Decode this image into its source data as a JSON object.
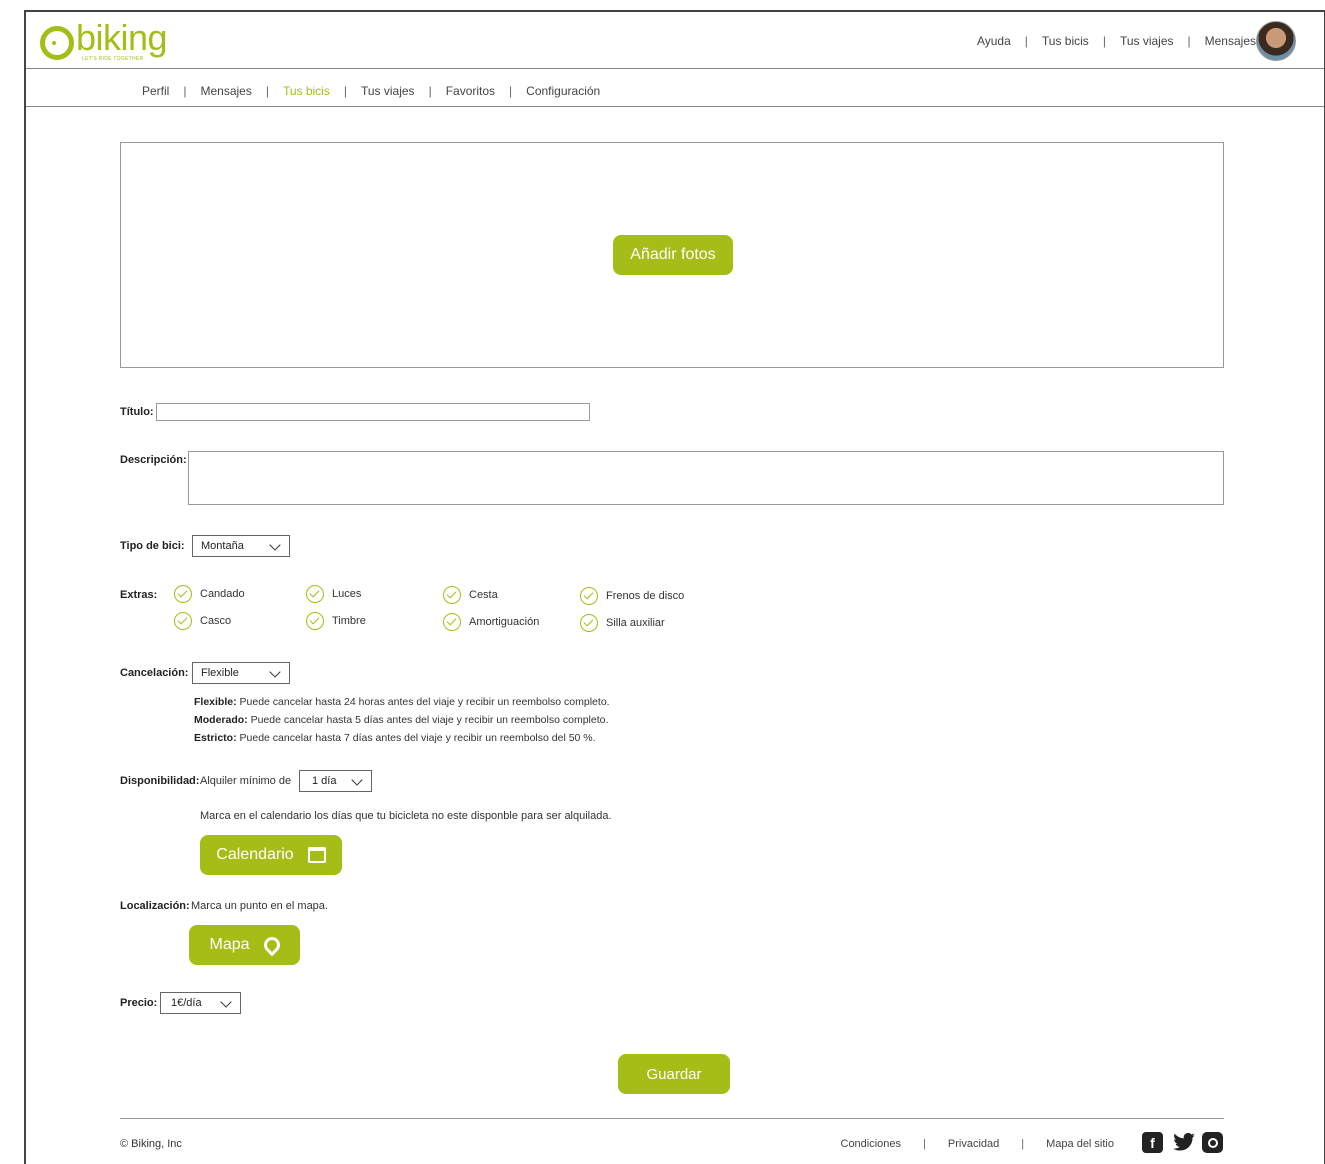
{
  "brand": {
    "name": "biking",
    "tagline": "LET'S RIDE TOGETHER",
    "accent": "#a5bd17"
  },
  "topnav": [
    "Ayuda",
    "Tus bicis",
    "Tus viajes",
    "Mensajes"
  ],
  "subnav": [
    "Perfil",
    "Mensajes",
    "Tus bicis",
    "Tus viajes",
    "Favoritos",
    "Configuración"
  ],
  "photos": {
    "button": "Añadir fotos"
  },
  "form": {
    "titulo_label": "Título:",
    "titulo_value": "",
    "descripcion_label": "Descripción:",
    "descripcion_value": "",
    "tipo_label": "Tipo de bici:",
    "tipo_value": "Montaña",
    "extras_label": "Extras:",
    "extras": [
      "Candado",
      "Luces",
      "Cesta",
      "Frenos de disco",
      "Casco",
      "Timbre",
      "Amortiguación",
      "Silla auxiliar"
    ],
    "cancel_label": "Cancelación:",
    "cancel_value": "Flexible",
    "policies": [
      {
        "name": "Flexible:",
        "text": " Puede cancelar hasta 24 horas antes del viaje y recibir un reembolso completo."
      },
      {
        "name": "Moderado:",
        "text": " Puede cancelar hasta 5 días antes del viaje y recibir un reembolso completo."
      },
      {
        "name": "Estricto:",
        "text": " Puede cancelar hasta 7 días antes del viaje y recibir un reembolso del 50 %."
      }
    ],
    "disp_label": "Disponibilidad:",
    "disp_text": "Alquiler mínimo de",
    "disp_value": "1 día",
    "calendar_hint": "Marca en el calendario los días que tu bicicleta no este disponble para ser alquilada.",
    "calendar_button": "Calendario",
    "loc_label": "Localización:",
    "loc_text": "Marca un punto en el mapa.",
    "map_button": "Mapa",
    "precio_label": "Precio:",
    "precio_value": "1€/día",
    "save_button": "Guardar"
  },
  "footer": {
    "copyright": "© Biking, Inc",
    "links": [
      "Condiciones",
      "Privacidad",
      "Mapa del sitio"
    ],
    "social": [
      "facebook-icon",
      "twitter-icon",
      "instagram-icon"
    ]
  }
}
